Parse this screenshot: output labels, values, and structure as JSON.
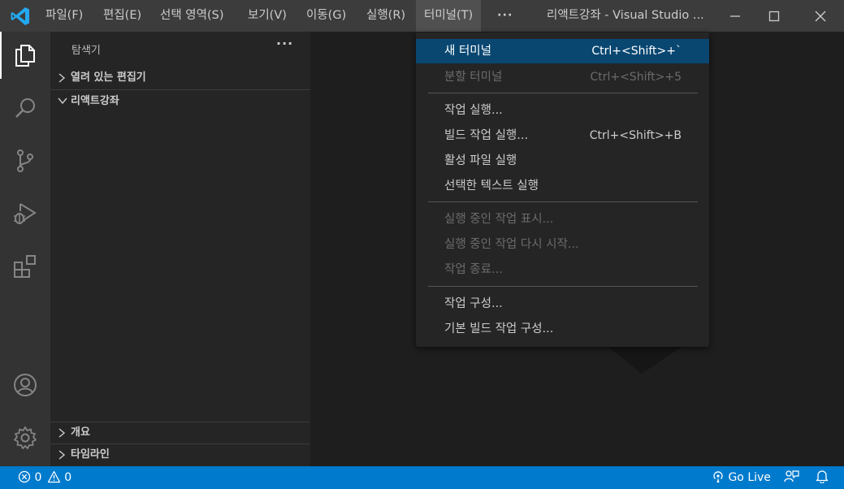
{
  "titlebar": {
    "menus": [
      "파일(F)",
      "편집(E)",
      "선택 영역(S)",
      "보기(V)",
      "이동(G)",
      "실행(R)",
      "터미널(T)"
    ],
    "more": "···",
    "window_title": "리액트강좌 - Visual Studio ..."
  },
  "sidebar": {
    "title": "탐색기",
    "more": "···",
    "sections": {
      "open_editors": "열려 있는 편집기",
      "project": "리액트강좌",
      "outline": "개요",
      "timeline": "타임라인"
    }
  },
  "terminal_menu": {
    "items": [
      {
        "label": "새 터미널",
        "shortcut": "Ctrl+<Shift>+`",
        "state": "selected"
      },
      {
        "label": "분할 터미널",
        "shortcut": "Ctrl+<Shift>+5",
        "state": "disabled"
      },
      {
        "label": "작업 실행...",
        "shortcut": "",
        "state": "enabled"
      },
      {
        "label": "빌드 작업 실행...",
        "shortcut": "Ctrl+<Shift>+B",
        "state": "enabled"
      },
      {
        "label": "활성 파일 실행",
        "shortcut": "",
        "state": "enabled"
      },
      {
        "label": "선택한 텍스트 실행",
        "shortcut": "",
        "state": "enabled"
      },
      {
        "label": "실행 중인 작업 표시...",
        "shortcut": "",
        "state": "disabled"
      },
      {
        "label": "실행 중인 작업 다시 시작...",
        "shortcut": "",
        "state": "disabled"
      },
      {
        "label": "작업 종료...",
        "shortcut": "",
        "state": "disabled"
      },
      {
        "label": "작업 구성...",
        "shortcut": "",
        "state": "enabled"
      },
      {
        "label": "기본 빌드 작업 구성...",
        "shortcut": "",
        "state": "enabled"
      }
    ]
  },
  "statusbar": {
    "errors": "0",
    "warnings": "0",
    "go_live": "Go Live"
  },
  "colors": {
    "accent": "#007acc",
    "titlebar": "#3c3c3c",
    "activitybar": "#333333",
    "sidebar": "#252526",
    "editor": "#1e1e1e",
    "menu_selected": "#094771",
    "vscode_logo": "#23a9f2"
  },
  "icons": {
    "activity": [
      "files-icon",
      "search-icon",
      "source-control-icon",
      "run-debug-icon",
      "extensions-icon",
      "account-icon",
      "settings-gear-icon"
    ],
    "window": [
      "minimize-icon",
      "maximize-icon",
      "close-icon"
    ],
    "statusbar": [
      "error-icon",
      "warning-icon",
      "broadcast-icon",
      "feedback-icon",
      "bell-icon"
    ]
  }
}
